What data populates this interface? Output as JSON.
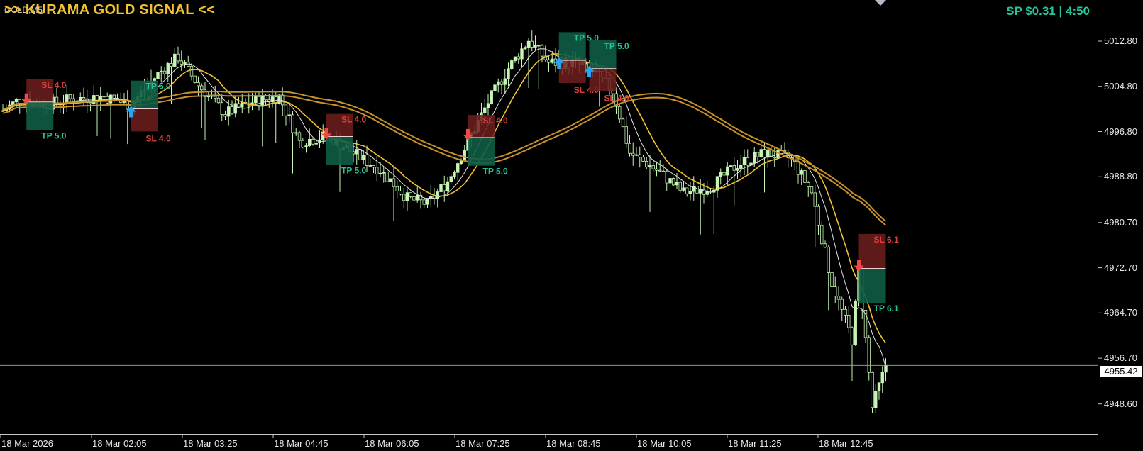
{
  "window": {
    "symbol": "GOLD,M5",
    "title": ">> KURAMA GOLD SIGNAL <<",
    "spread_text": "SP $0.31  |  4:50",
    "current_price": "4955.42"
  },
  "colors": {
    "background": "#000000",
    "bull_candle": "#c6f5b5",
    "bear_candle": "#000000",
    "ma_fast": "#e6e6e6",
    "ma_mid": "#f2c230",
    "ma_slow": "#c8922a",
    "sl_box": "#6e1d1d",
    "tp_box": "#0e5c45",
    "sl_text": "#e0403c",
    "tp_text": "#26c49a",
    "arrow_up": "#2aa4f4",
    "arrow_down": "#f04848"
  },
  "price_axis": {
    "ticks": [
      "5012.80",
      "5004.80",
      "4996.80",
      "4988.80",
      "4980.70",
      "4972.70",
      "4964.70",
      "4956.70",
      "4948.60"
    ]
  },
  "time_axis": {
    "ticks": [
      "18 Mar 2026",
      "18 Mar 02:05",
      "18 Mar 03:25",
      "18 Mar 04:45",
      "18 Mar 06:05",
      "18 Mar 07:25",
      "18 Mar 08:45",
      "18 Mar 10:05",
      "18 Mar 11:25",
      "18 Mar 12:45"
    ]
  },
  "signals": [
    {
      "direction": "sell",
      "idx": 7,
      "sl_label": "SL 4.0",
      "tp_label": "TP 5.0"
    },
    {
      "direction": "buy",
      "idx": 38,
      "sl_label": "SL 4.0",
      "tp_label": "TP 5.0"
    },
    {
      "direction": "sell",
      "idx": 96,
      "sl_label": "SL 4.0",
      "tp_label": "TP 5.0"
    },
    {
      "direction": "sell",
      "idx": 138,
      "sl_label": "SL 4.0",
      "tp_label": "TP 5.0"
    },
    {
      "direction": "buy",
      "idx": 165,
      "sl_label": "SL 4.0",
      "tp_label": "TP 5.0"
    },
    {
      "direction": "buy",
      "idx": 174,
      "sl_label": "SL 4.0",
      "tp_label": "TP 5.0"
    },
    {
      "direction": "sell",
      "idx": 254,
      "sl_label": "SL 6.1",
      "tp_label": "TP 6.1"
    }
  ],
  "price_path": [
    [
      0,
      5000.5
    ],
    [
      5,
      5002.5
    ],
    [
      12,
      5001.5
    ],
    [
      20,
      5002.5
    ],
    [
      30,
      5003.0
    ],
    [
      38,
      5001.5
    ],
    [
      46,
      5007.0
    ],
    [
      52,
      5010.0
    ],
    [
      58,
      5005.0
    ],
    [
      66,
      5000.0
    ],
    [
      74,
      5002.0
    ],
    [
      82,
      5003.0
    ],
    [
      88,
      4995.0
    ],
    [
      96,
      4996.0
    ],
    [
      104,
      4993.0
    ],
    [
      112,
      4990.0
    ],
    [
      120,
      4985.0
    ],
    [
      126,
      4984.0
    ],
    [
      132,
      4988.0
    ],
    [
      138,
      4995.0
    ],
    [
      144,
      5002.0
    ],
    [
      150,
      5008.0
    ],
    [
      156,
      5013.0
    ],
    [
      162,
      5009.0
    ],
    [
      170,
      5009.0
    ],
    [
      176,
      5007.0
    ],
    [
      181,
      5004.0
    ],
    [
      186,
      4993.0
    ],
    [
      194,
      4990.0
    ],
    [
      202,
      4986.0
    ],
    [
      210,
      4987.0
    ],
    [
      218,
      4991.0
    ],
    [
      226,
      4993.0
    ],
    [
      234,
      4992.0
    ],
    [
      240,
      4986.0
    ],
    [
      246,
      4970.0
    ],
    [
      252,
      4960.0
    ],
    [
      254,
      4972.0
    ],
    [
      256,
      4960.0
    ],
    [
      258,
      4948.0
    ],
    [
      262,
      4955.42
    ]
  ]
}
